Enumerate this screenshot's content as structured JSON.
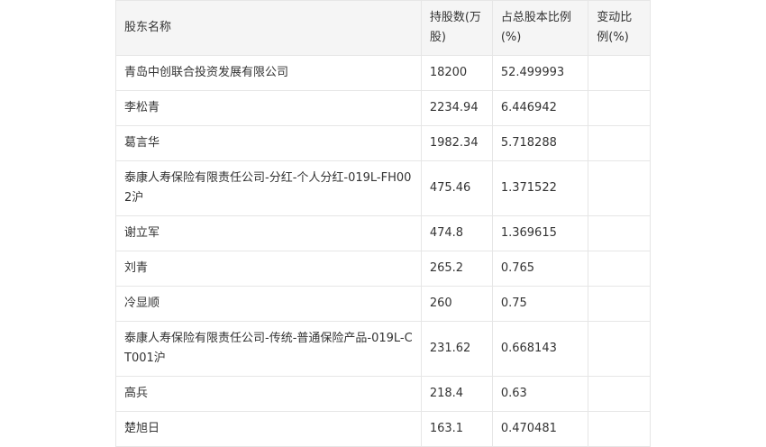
{
  "table": {
    "headers": {
      "name": "股东名称",
      "shares": "持股数(万股)",
      "ratio": "占总股本比例(%)",
      "change": "变动比例(%)"
    },
    "rows": [
      {
        "name": "青岛中创联合投资发展有限公司",
        "shares": "18200",
        "ratio": "52.499993",
        "change": ""
      },
      {
        "name": "李松青",
        "shares": "2234.94",
        "ratio": "6.446942",
        "change": ""
      },
      {
        "name": "葛言华",
        "shares": "1982.34",
        "ratio": "5.718288",
        "change": ""
      },
      {
        "name": "泰康人寿保险有限责任公司-分红-个人分红-019L-FH002沪",
        "shares": "475.46",
        "ratio": "1.371522",
        "change": ""
      },
      {
        "name": "谢立军",
        "shares": "474.8",
        "ratio": "1.369615",
        "change": ""
      },
      {
        "name": "刘青",
        "shares": "265.2",
        "ratio": "0.765",
        "change": ""
      },
      {
        "name": "冷显顺",
        "shares": "260",
        "ratio": "0.75",
        "change": ""
      },
      {
        "name": "泰康人寿保险有限责任公司-传统-普通保险产品-019L-CT001沪",
        "shares": "231.62",
        "ratio": "0.668143",
        "change": ""
      },
      {
        "name": "高兵",
        "shares": "218.4",
        "ratio": "0.63",
        "change": ""
      },
      {
        "name": "楚旭日",
        "shares": "163.1",
        "ratio": "0.470481",
        "change": ""
      }
    ]
  }
}
